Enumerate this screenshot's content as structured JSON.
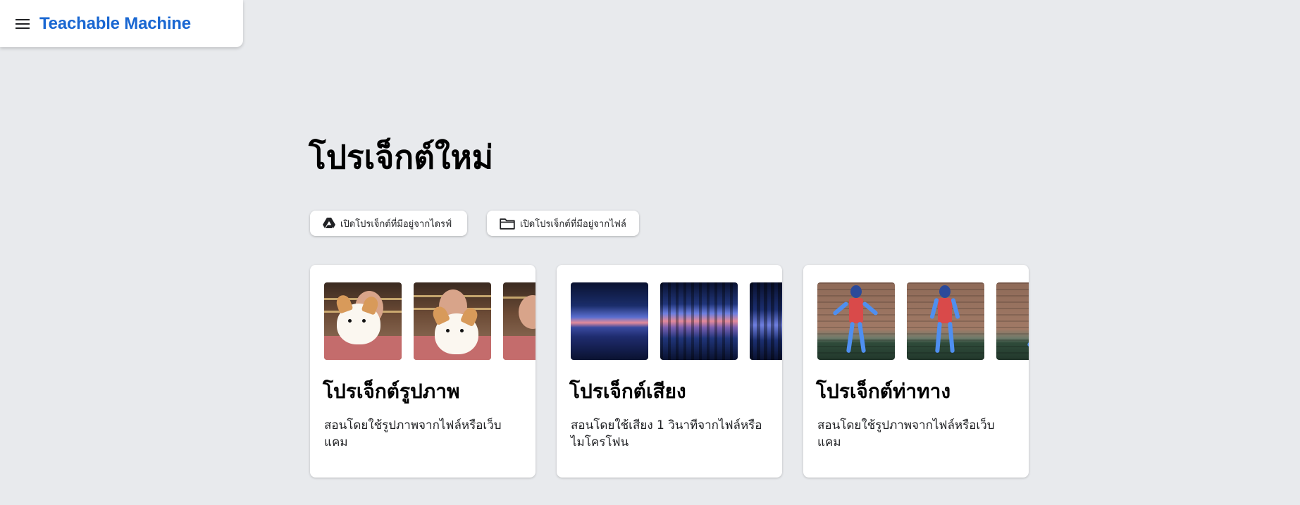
{
  "app": {
    "brand": "Teachable Machine",
    "menu_icon": "menu-icon",
    "brand_color": "#1967d2"
  },
  "main": {
    "title": "โปรเจ็กต์ใหม่",
    "open_drive_label": "เปิดโปรเจ็กต์ที่มีอยู่จากไดรฟ์",
    "open_drive_icon": "google-drive-icon",
    "open_file_label": "เปิดโปรเจ็กต์ที่มีอยู่จากไฟล์",
    "open_file_icon": "folder-icon"
  },
  "projects": [
    {
      "title": "โปรเจ็กต์รูปภาพ",
      "description": "สอนโดยใช้รูปภาพจากไฟล์หรือเว็บแคม"
    },
    {
      "title": "โปรเจ็กต์เสียง",
      "description": "สอนโดยใช้เสียง 1 วินาทีจากไฟล์หรือไมโครโฟน"
    },
    {
      "title": "โปรเจ็กต์ท่าทาง",
      "description": "สอนโดยใช้รูปภาพจากไฟล์หรือเว็บแคม"
    }
  ]
}
